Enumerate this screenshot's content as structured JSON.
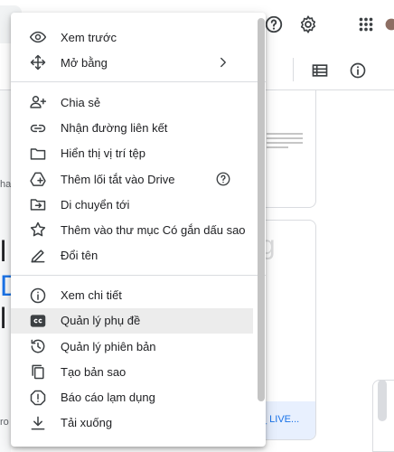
{
  "menu": {
    "groups": [
      [
        {
          "label": "Xem trước",
          "icon": "eye-icon"
        },
        {
          "label": "Mở bằng",
          "icon": "move-icon",
          "suffix": "chevron-right-icon"
        }
      ],
      [
        {
          "label": "Chia sẻ",
          "icon": "person-add-icon"
        },
        {
          "label": "Nhận đường liên kết",
          "icon": "link-icon"
        },
        {
          "label": "Hiển thị vị trí tệp",
          "icon": "folder-icon"
        },
        {
          "label": "Thêm lối tắt vào Drive",
          "icon": "add-shortcut-drive-icon",
          "suffix": "help-icon"
        },
        {
          "label": "Di chuyển tới",
          "icon": "drive-move-icon"
        },
        {
          "label": "Thêm vào thư mục Có gắn dấu sao",
          "icon": "star-icon"
        },
        {
          "label": "Đổi tên",
          "icon": "pencil-icon"
        }
      ],
      [
        {
          "label": "Xem chi tiết",
          "icon": "info-icon"
        },
        {
          "label": "Quản lý phụ đề",
          "icon": "captions-icon",
          "active": true
        },
        {
          "label": "Quản lý phiên bản",
          "icon": "history-icon"
        },
        {
          "label": "Tạo bản sao",
          "icon": "copy-icon"
        },
        {
          "label": "Báo cáo lạm dụng",
          "icon": "report-icon"
        },
        {
          "label": "Tải xuống",
          "icon": "download-icon"
        }
      ]
    ]
  },
  "background": {
    "file_caption": "_ LIVE...",
    "left_text_1": "ha",
    "left_text_2": "ro",
    "big_glyphs": [
      "l",
      "D",
      "l"
    ],
    "watermark_text": "uantrimang"
  },
  "colors": {
    "accent": "#1a73e8",
    "active_item_bg": "#ececec",
    "icon": "#3c4043"
  }
}
